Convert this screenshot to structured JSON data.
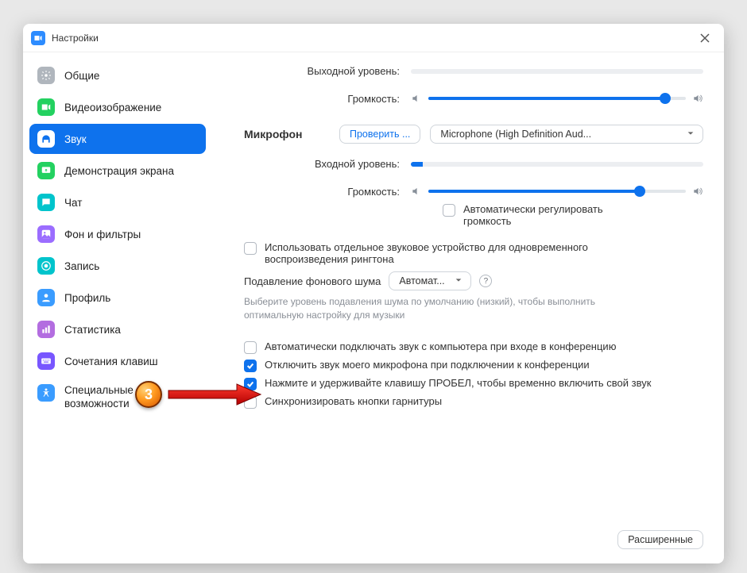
{
  "window": {
    "title": "Настройки"
  },
  "sidebar": {
    "items": [
      {
        "label": "Общие"
      },
      {
        "label": "Видеоизображение"
      },
      {
        "label": "Звук"
      },
      {
        "label": "Демонстрация экрана"
      },
      {
        "label": "Чат"
      },
      {
        "label": "Фон и фильтры"
      },
      {
        "label": "Запись"
      },
      {
        "label": "Профиль"
      },
      {
        "label": "Статистика"
      },
      {
        "label": "Сочетания клавиш"
      },
      {
        "label": "Специальные возможности"
      }
    ],
    "active_index": 2
  },
  "audio": {
    "output_level_label": "Выходной уровень:",
    "output_volume_label": "Громкость:",
    "output_volume_pct": 92,
    "mic_section": "Микрофон",
    "mic_test_btn": "Проверить ...",
    "mic_select": "Microphone (High Definition Aud...",
    "input_level_label": "Входной уровень:",
    "input_level_pct": 4,
    "input_volume_label": "Громкость:",
    "input_volume_pct": 82,
    "auto_gain_label": "Автоматически регулировать громкость",
    "auto_gain_checked": false,
    "ringtone_label": "Использовать отдельное звуковое устройство для одновременного воспроизведения рингтона",
    "ringtone_checked": false,
    "noise_label": "Подавление фонового шума",
    "noise_select": "Автомат...",
    "noise_desc": "Выберите уровень подавления шума по умолчанию (низкий), чтобы выполнить оптимальную настройку для музыки",
    "opts": [
      {
        "label": "Автоматически подключать звук с компьютера при входе в конференцию",
        "checked": false
      },
      {
        "label": "Отключить звук моего микрофона при подключении к конференции",
        "checked": true
      },
      {
        "label": "Нажмите и удерживайте клавишу ПРОБЕЛ, чтобы временно включить свой звук",
        "checked": true
      },
      {
        "label": "Синхронизировать кнопки гарнитуры",
        "checked": false
      }
    ],
    "advanced_btn": "Расширенные"
  },
  "annotation": {
    "step": "3"
  }
}
